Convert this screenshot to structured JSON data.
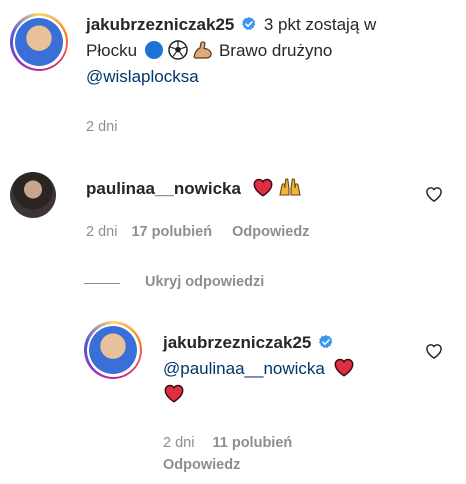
{
  "post": {
    "username": "jakubrzezniczak25",
    "verified": true,
    "caption_1": "3 pkt zostają w",
    "caption_2": "Płocku",
    "caption_3": "Brawo drużyno",
    "mention": "@wislaplocksa",
    "time": "2 dni"
  },
  "comment": {
    "username": "paulinaa__nowicka",
    "time": "2 dni",
    "likes": "17 polubień",
    "reply_label": "Odpowiedz"
  },
  "replies_toggle": "Ukryj odpowiedzi",
  "reply": {
    "username": "jakubrzezniczak25",
    "verified": true,
    "mention": "@paulinaa__nowicka",
    "time": "2 dni",
    "likes": "11 polubień",
    "reply_label": "Odpowiedz"
  },
  "icons": {
    "verified": "verified-badge-icon",
    "like": "heart-outline-icon",
    "emoji_ball_blue": "blue-circle-emoji",
    "emoji_soccer": "soccer-ball-emoji",
    "emoji_muscle": "flexed-biceps-emoji",
    "emoji_heart": "red-heart-emoji",
    "emoji_raised_hands": "raised-hands-emoji"
  },
  "colors": {
    "text": "#262626",
    "secondary": "#8e8e8e",
    "mention": "#00376b",
    "verified": "#3897f0",
    "heart": "#dd2e44"
  }
}
